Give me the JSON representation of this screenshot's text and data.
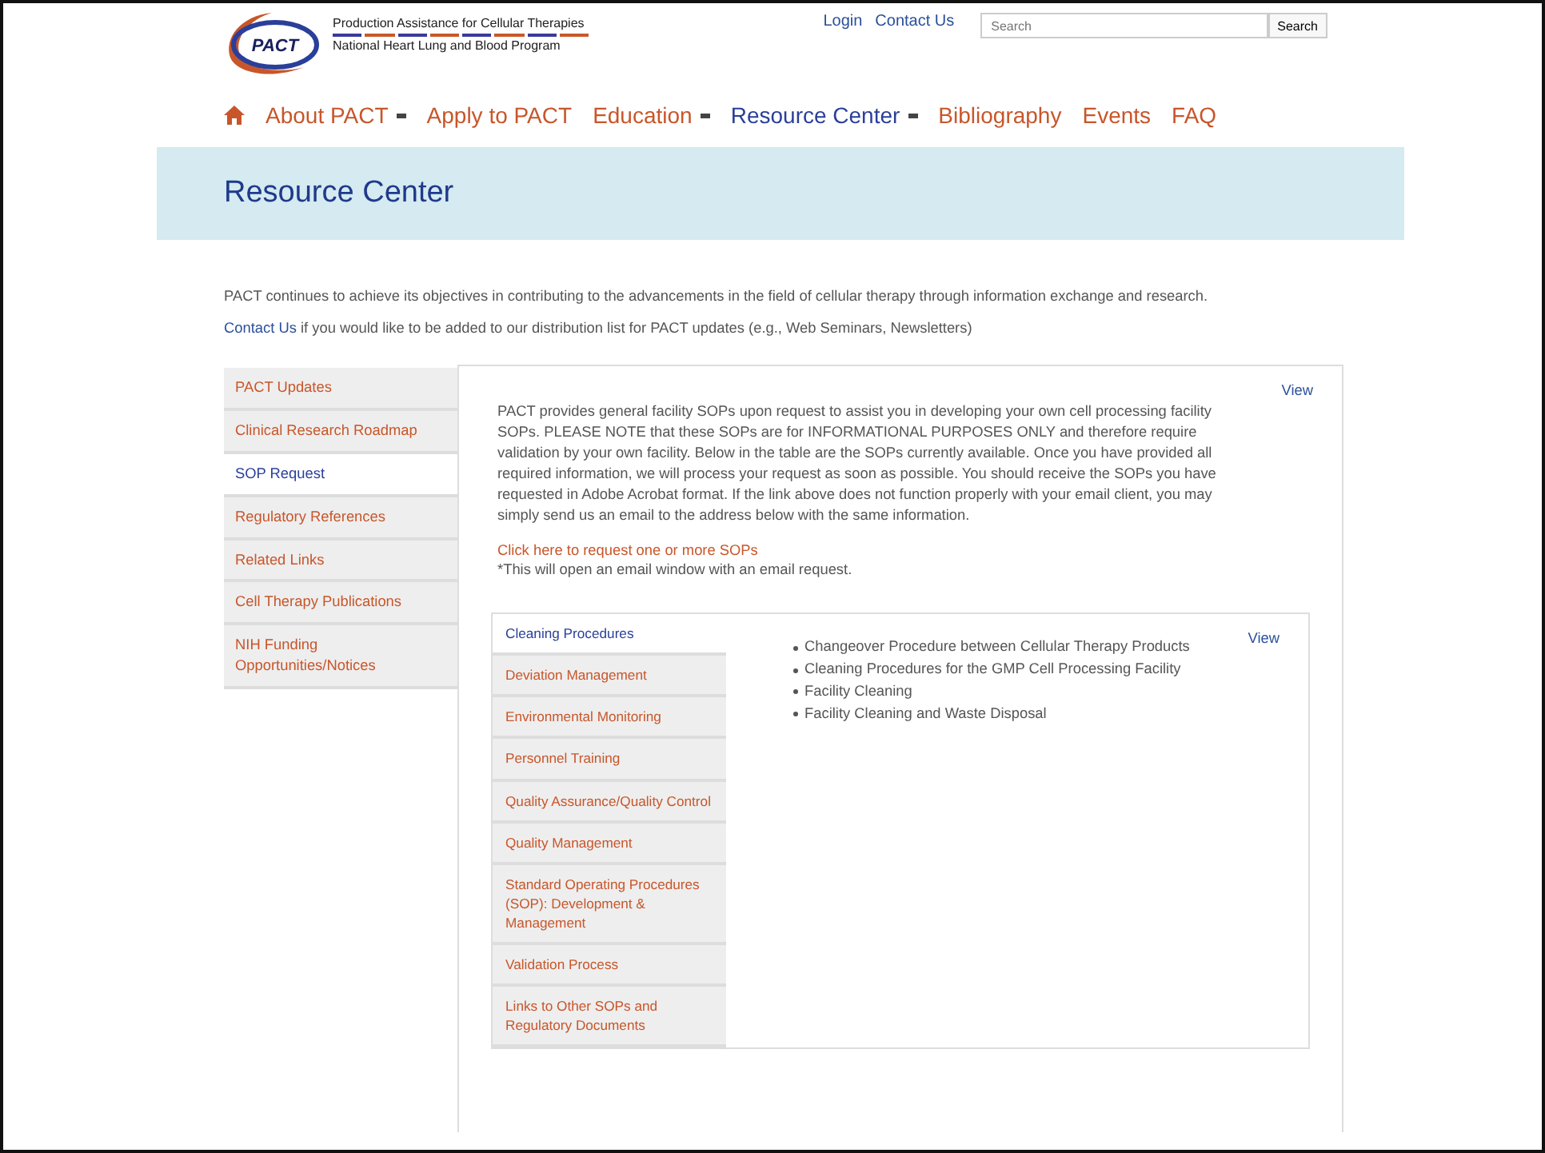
{
  "logo": {
    "mark": "PACT",
    "line_1": "Production Assistance for Cellular Therapies",
    "line_2": "National Heart Lung and Blood Program"
  },
  "top_links": [
    "Login",
    "Contact Us"
  ],
  "search": {
    "placeholder": "Search",
    "button": "Search"
  },
  "nav": [
    {
      "label": "About PACT",
      "dropdown": true,
      "selected": false
    },
    {
      "label": "Apply to PACT",
      "dropdown": false,
      "selected": false
    },
    {
      "label": "Education",
      "dropdown": true,
      "selected": false
    },
    {
      "label": "Resource Center",
      "dropdown": true,
      "selected": true
    },
    {
      "label": "Bibliography",
      "dropdown": false,
      "selected": false
    },
    {
      "label": "Events",
      "dropdown": false,
      "selected": false
    },
    {
      "label": "FAQ",
      "dropdown": false,
      "selected": false
    }
  ],
  "banner": {
    "title": "Resource Center"
  },
  "intro": {
    "text": "PACT continues to achieve its objectives in contributing to the advancements in the field of cellular therapy through information exchange and research.",
    "link": "Contact Us",
    "link_tail": " if you would like to be added to our distribution list for PACT updates (e.g., Web Seminars, Newsletters)"
  },
  "sidebar": [
    {
      "label": "PACT Updates",
      "selected": false
    },
    {
      "label": "Clinical Research Roadmap",
      "selected": false
    },
    {
      "label": "SOP Request",
      "selected": true
    },
    {
      "label": "Regulatory References",
      "selected": false
    },
    {
      "label": "Related Links",
      "selected": false
    },
    {
      "label": "Cell Therapy Publications",
      "selected": false
    },
    {
      "label": "NIH Funding Opportunities/Notices",
      "selected": false
    }
  ],
  "content": {
    "view": "View",
    "paragraph": "PACT provides general facility SOPs upon request to assist you in developing your own cell processing facility SOPs. PLEASE NOTE that these SOPs are for INFORMATIONAL PURPOSES ONLY and therefore require validation by your own facility. Below in the table are the SOPs currently available. Once you have provided all required information, we will process your request as soon as possible. You should receive the SOPs you have requested in Adobe Acrobat format.  If the link above does not function properly with your email client, you may simply send us an email to the address below with the same information.",
    "request_link": "Click here to request one or more SOPs",
    "note": "*This will open an email window with an email request."
  },
  "sop_tabs": [
    {
      "label": "Cleaning Procedures",
      "selected": true
    },
    {
      "label": "Deviation Management",
      "selected": false
    },
    {
      "label": "Environmental Monitoring",
      "selected": false
    },
    {
      "label": "Personnel Training",
      "selected": false
    },
    {
      "label": "Quality Assurance/Quality Control",
      "selected": false
    },
    {
      "label": "Quality Management",
      "selected": false
    },
    {
      "label": "Standard Operating Procedures (SOP): Development & Management",
      "selected": false
    },
    {
      "label": "Validation Process",
      "selected": false
    },
    {
      "label": "Links to Other SOPs and Regulatory Documents",
      "selected": false
    }
  ],
  "sop_panel": {
    "view": "View",
    "items": [
      "Changeover Procedure between Cellular Therapy Products",
      "Cleaning Procedures for the GMP Cell Processing Facility",
      "Facility Cleaning",
      "Facility Cleaning and Waste Disposal"
    ]
  }
}
